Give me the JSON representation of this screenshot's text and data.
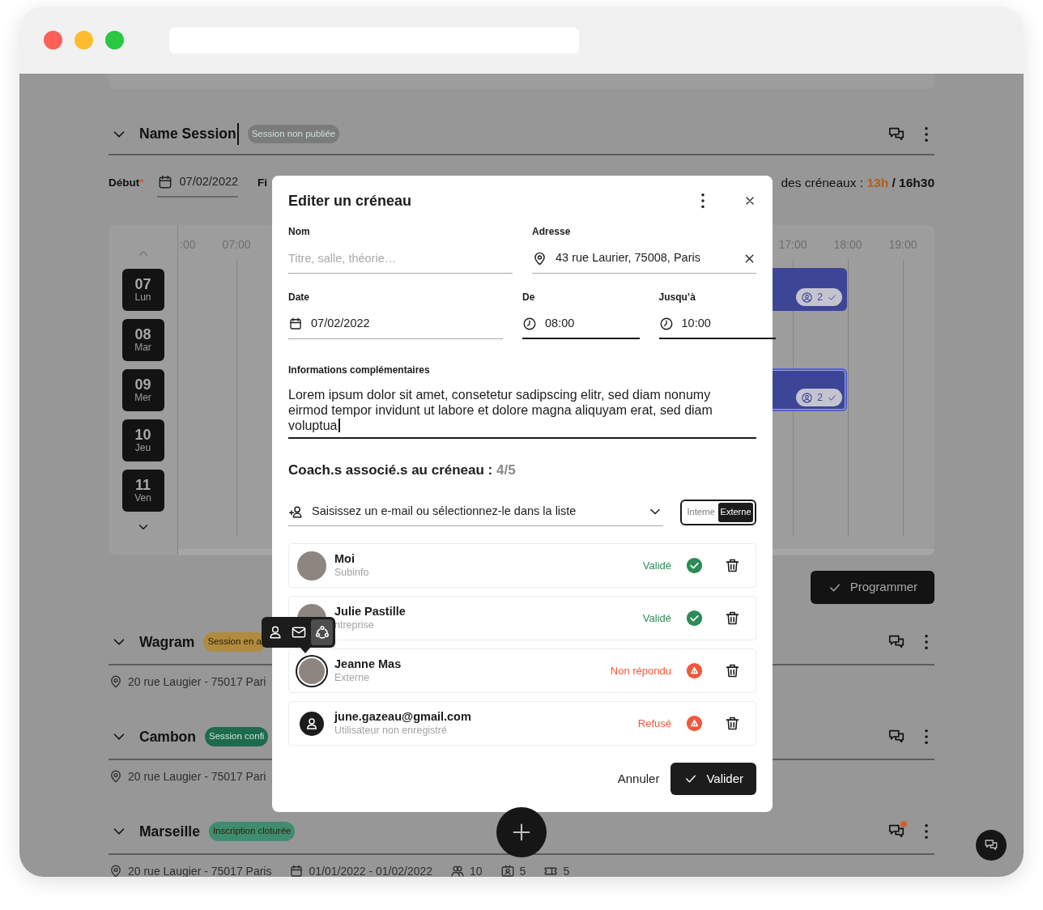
{
  "session": {
    "title": "Name Session",
    "badge": "Session non publiée",
    "color": "#7b7b7b",
    "chat_unread": false,
    "start_label": "Début",
    "required_mark": "*",
    "start_date": "07/02/2022",
    "end_label": "Fi",
    "duration_label": "des créneaux :",
    "duration_used": "13h",
    "duration_total": "/ 16h30"
  },
  "calendar": {
    "hours_left": [
      ":00",
      "07:00"
    ],
    "hours_right": [
      "17:00",
      "18:00",
      "19:00"
    ],
    "days": [
      {
        "number": "07",
        "name": "Lun"
      },
      {
        "number": "08",
        "name": "Mar"
      },
      {
        "number": "09",
        "name": "Mer"
      },
      {
        "number": "10",
        "name": "Jeu"
      },
      {
        "number": "11",
        "name": "Ven"
      }
    ],
    "events": [
      {
        "count": "2",
        "selected": false
      },
      {
        "count": "2",
        "selected": true
      }
    ]
  },
  "program_button": "Programmer",
  "sessions": [
    {
      "title": "Wagram",
      "badge": "Session en a",
      "color": "#b08a3e",
      "chat_unread": false,
      "address": "20 rue Laugier - 75017 Pari"
    },
    {
      "title": "Cambon",
      "badge": "Session confi",
      "color": "#1e6a4e",
      "chat_unread": false,
      "address": "20 rue Laugier - 75017 Pari"
    },
    {
      "title": "Marseille",
      "badge": "Inscription cloturée",
      "color": "#3f8c70",
      "chat_unread": true,
      "address": "20 rue Laugier - 75017 Paris",
      "dates": "01/01/2022 - 01/02/2022",
      "participants": "10",
      "stat_2": "5",
      "stat_3": "5"
    }
  ],
  "modal": {
    "title": "Editer un créneau",
    "name_label": "Nom",
    "name_placeholder": "Titre, salle, théorie…",
    "address_label": "Adresse",
    "address_value": "43 rue Laurier, 75008, Paris",
    "date_label": "Date",
    "date_value": "07/02/2022",
    "from_label": "De",
    "from_value": "08:00",
    "to_label": "Jusqu’à",
    "to_value": "10:00",
    "info_label": "Informations complémentaires",
    "info_value": "Lorem ipsum dolor sit amet, consetetur sadipscing elitr, sed diam nonumy eirmod tempor invidunt ut labore et dolore magna aliquyam erat, sed diam voluptua",
    "coaches_title": "Coach.s associé.s au créneau :",
    "coaches_count": "4/5",
    "coach_search_placeholder": "Saisissez un e-mail ou sélectionnez-le dans la liste",
    "toggle": [
      {
        "label": "Interne",
        "selected": false
      },
      {
        "label": "Externe",
        "selected": true
      }
    ],
    "coaches": [
      {
        "name": "Moi",
        "subinfo": "Subinfo",
        "has_photo": true,
        "focused": false,
        "kind": "validated",
        "status_label": "Validé"
      },
      {
        "name": "Julie Pastille",
        "subinfo": "ntreprise",
        "has_photo": true,
        "focused": false,
        "kind": "validated",
        "status_label": "Validé"
      },
      {
        "name": "Jeanne Mas",
        "subinfo": "Externe",
        "has_photo": true,
        "focused": true,
        "kind": "unanswered",
        "status_label": "Non répondu"
      },
      {
        "name": "june.gazeau@gmail.com",
        "subinfo": "Utilisateur non enregistré",
        "has_photo": false,
        "focused": false,
        "kind": "refused",
        "status_label": "Refusé"
      }
    ],
    "tooltip_options": [
      {
        "kind": "person",
        "selected": false
      },
      {
        "kind": "mail",
        "selected": false
      },
      {
        "kind": "group",
        "selected": true
      }
    ],
    "cancel": "Annuler",
    "confirm": "Valider"
  }
}
